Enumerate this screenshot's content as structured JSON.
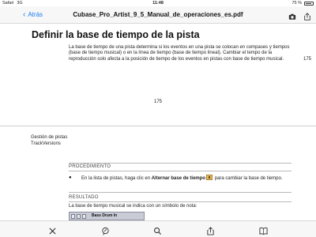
{
  "status_bar": {
    "carrier": "Safari",
    "network": "3G",
    "time": "11:48",
    "battery": "75 %"
  },
  "nav": {
    "back_label": "Atrás",
    "title": "Cubase_Pro_Artist_9_5_Manual_de_operaciones_es.pdf",
    "icons": [
      "camera-icon",
      "share-icon"
    ]
  },
  "page": {
    "heading": "Definir la base de tiempo de la pista",
    "intro": "La base de tiempo de una pista determina si los eventos en una pista se colocan en compases y tiempos (base de tiempo musical) o en la línea de tiempo (base de tiempo lineal). Cambiar el tempo de la reproducción solo afecta a la posición de tiempo de los eventos en pistas con base de tiempo musical.",
    "margin_number": "175",
    "page_number": "175",
    "running_head_1": "Gestión de pistas",
    "running_head_2": "TrackVersions",
    "procedure_label": "PROCEDIMIENTO",
    "bullet": "●",
    "step_before": "En la lista de pistas, haga clic en ",
    "step_bold": "Alternar base de tiempo",
    "step_after": " para cambiar la base de tiempo.",
    "result_label": "RESULTADO",
    "result_text": "La base de tiempo musical se indica con un símbolo de nota:",
    "track_name": "Bass Drum In"
  },
  "toolbar": {
    "icons": [
      "tools-icon",
      "annotate-icon",
      "search-icon",
      "share-icon",
      "bookmark-icon"
    ]
  }
}
